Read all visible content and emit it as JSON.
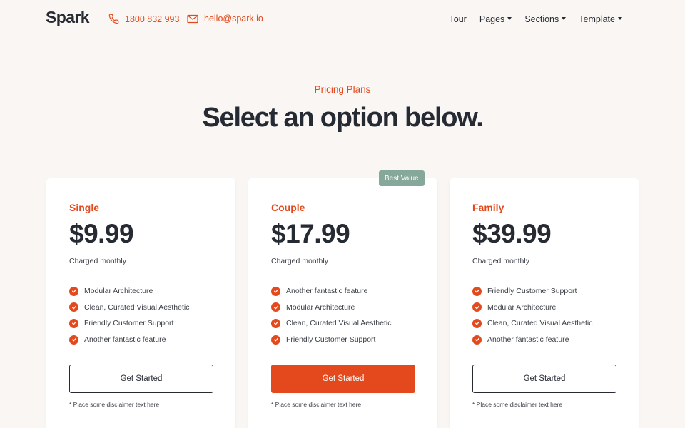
{
  "brand": {
    "logo": "Spark",
    "accent": "#e3491c",
    "badge_color": "#86a89b"
  },
  "contact": {
    "phone": {
      "icon": "phone-icon",
      "label": "1800 832 993"
    },
    "email": {
      "icon": "mail-icon",
      "label": "hello@spark.io"
    }
  },
  "nav": {
    "items": [
      {
        "label": "Tour",
        "dropdown": false
      },
      {
        "label": "Pages",
        "dropdown": true
      },
      {
        "label": "Sections",
        "dropdown": true
      },
      {
        "label": "Template",
        "dropdown": true
      }
    ]
  },
  "hero": {
    "eyebrow": "Pricing Plans",
    "title": "Select an option below."
  },
  "plans": [
    {
      "name": "Single",
      "price": "$9.99",
      "period": "Charged monthly",
      "features": [
        "Modular Architecture",
        "Clean, Curated Visual Aesthetic",
        "Friendly Customer Support",
        "Another fantastic feature"
      ],
      "cta": "Get Started",
      "disclaimer": "* Place some disclaimer text here"
    },
    {
      "name": "Couple",
      "badge": "Best Value",
      "price": "$17.99",
      "period": "Charged monthly",
      "features": [
        "Another fantastic feature",
        "Modular Architecture",
        "Clean, Curated Visual Aesthetic",
        "Friendly Customer Support"
      ],
      "cta": "Get Started",
      "disclaimer": "* Place some disclaimer text here"
    },
    {
      "name": "Family",
      "price": "$39.99",
      "period": "Charged monthly",
      "features": [
        "Friendly Customer Support",
        "Modular Architecture",
        "Clean, Curated Visual Aesthetic",
        "Another fantastic feature"
      ],
      "cta": "Get Started",
      "disclaimer": "* Place some disclaimer text here"
    }
  ]
}
